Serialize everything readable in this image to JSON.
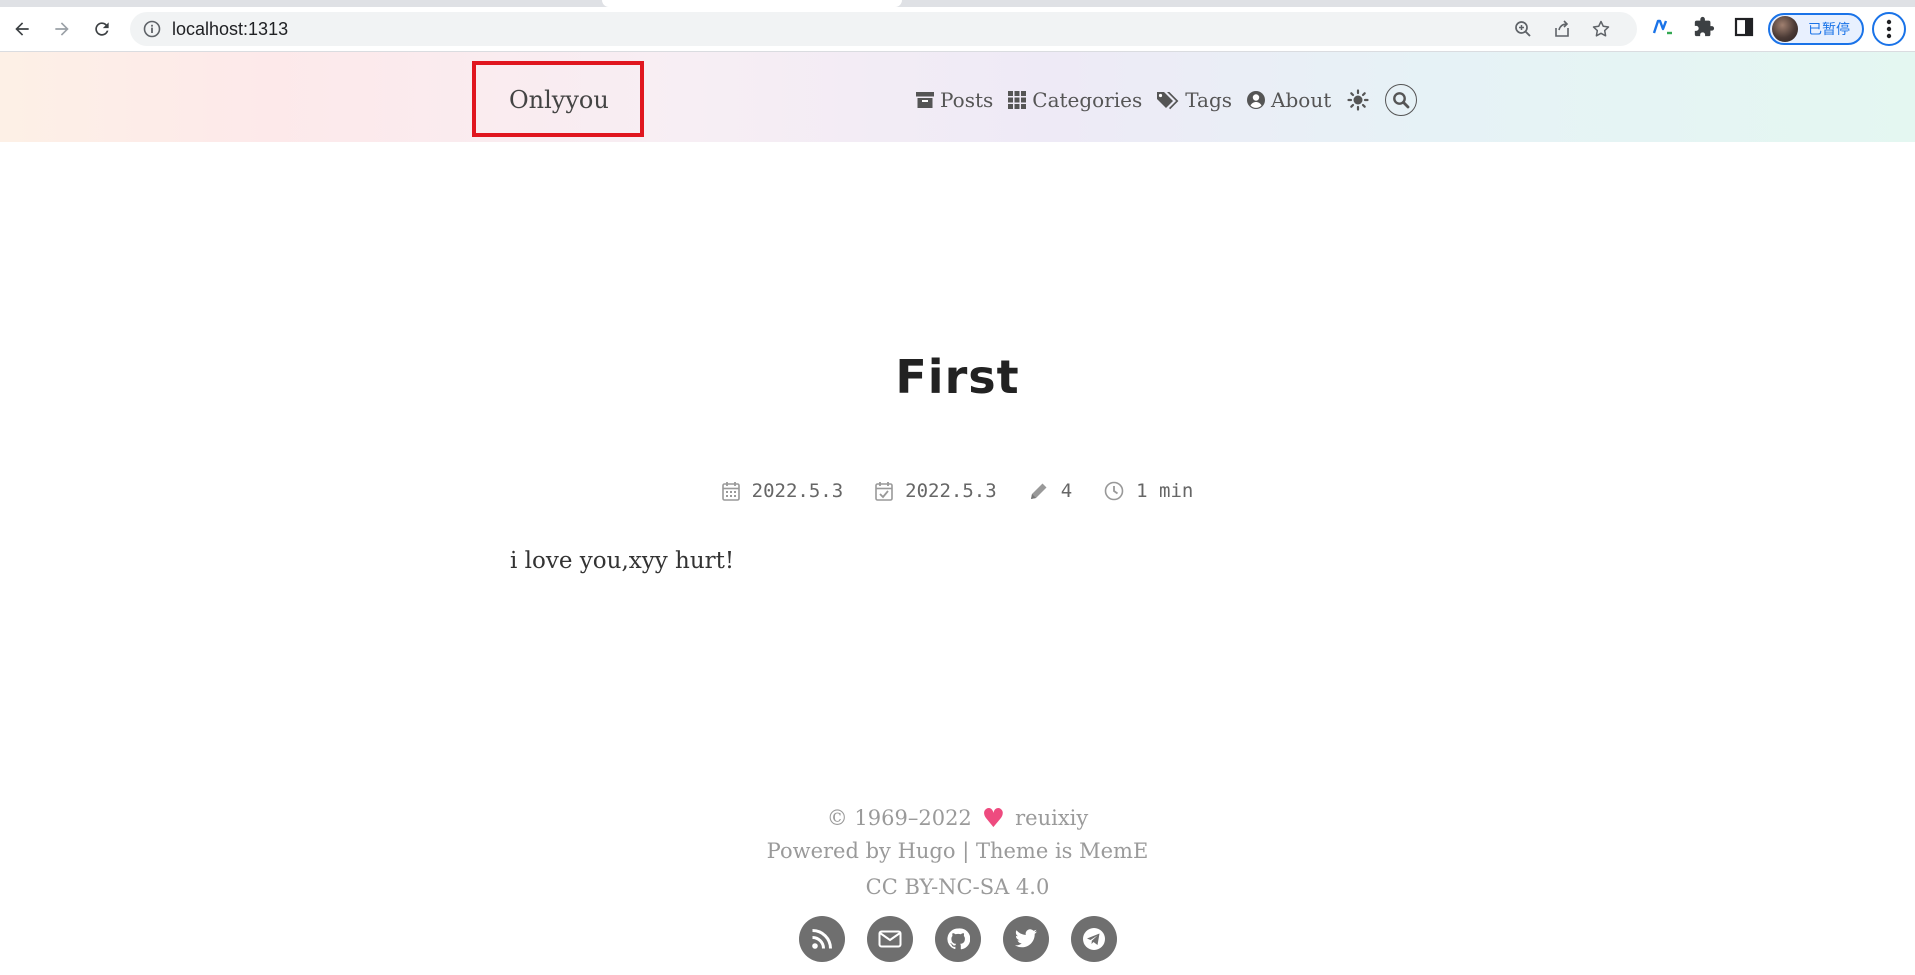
{
  "browser": {
    "url": "localhost:1313",
    "profile_label": "已暂停"
  },
  "site": {
    "brand": "Onlyyou",
    "nav": [
      {
        "label": "Posts",
        "icon": "archive-icon"
      },
      {
        "label": "Categories",
        "icon": "grid-icon"
      },
      {
        "label": "Tags",
        "icon": "tags-icon"
      },
      {
        "label": "About",
        "icon": "user-circle-icon"
      }
    ],
    "highlight_color": "#e0161f"
  },
  "post": {
    "title": "First",
    "meta": {
      "published": "2022.5.3",
      "updated": "2022.5.3",
      "word_count": "4",
      "read_time": "1 min"
    },
    "body": "i love you,xyy hurt!"
  },
  "footer": {
    "copyright_years": "© 1969–2022",
    "author": "reuixiy",
    "powered_prefix": "Powered by",
    "powered_link": "Hugo",
    "separator": "|",
    "theme_prefix": "Theme is",
    "theme_link": "MemE",
    "license": "CC BY-NC-SA 4.0",
    "heart_color": "#ee4b7f",
    "social": [
      "rss-icon",
      "email-icon",
      "github-icon",
      "twitter-icon",
      "telegram-icon"
    ]
  }
}
